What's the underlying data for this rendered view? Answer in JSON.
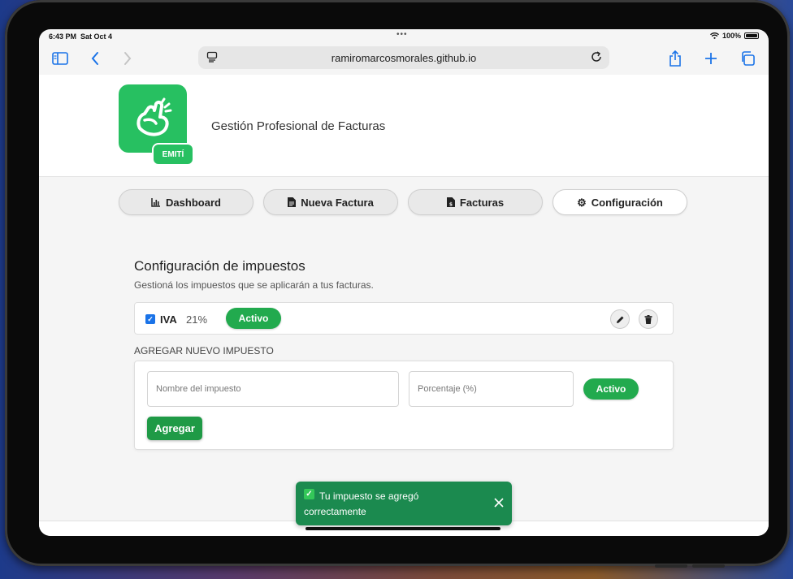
{
  "status": {
    "time": "6:43 PM",
    "date": "Sat Oct 4",
    "battery": "100%"
  },
  "browser": {
    "url": "ramiromarcosmorales.github.io"
  },
  "site": {
    "logo_badge": "EMITÍ",
    "tagline": "Gestión Profesional de Facturas"
  },
  "nav": {
    "items": [
      {
        "label": "Dashboard",
        "icon": "chart-icon"
      },
      {
        "label": "Nueva Factura",
        "icon": "document-icon"
      },
      {
        "label": "Facturas",
        "icon": "receipt-icon"
      },
      {
        "label": "Configuración",
        "icon": "gear-icon"
      }
    ],
    "active": "Configuración"
  },
  "taxes": {
    "title": "Configuración de impuestos",
    "subtitle": "Gestioná los impuestos que se aplicarán a tus facturas.",
    "items": [
      {
        "name": "IVA",
        "percent": "21%",
        "status": "Activo",
        "checked": true
      }
    ]
  },
  "add_tax": {
    "label": "AGREGAR NUEVO IMPUESTO",
    "name_placeholder": "Nombre del impuesto",
    "percent_placeholder": "Porcentaje (%)",
    "status_label": "Activo",
    "submit_label": "Agregar"
  },
  "toast": {
    "message": "Tu impuesto se agregó correctamente"
  },
  "colors": {
    "brand_green": "#27c061",
    "active_pill": "#22aa4e",
    "toast_bg": "#1b8a4f",
    "link_blue": "#1a73e8"
  }
}
